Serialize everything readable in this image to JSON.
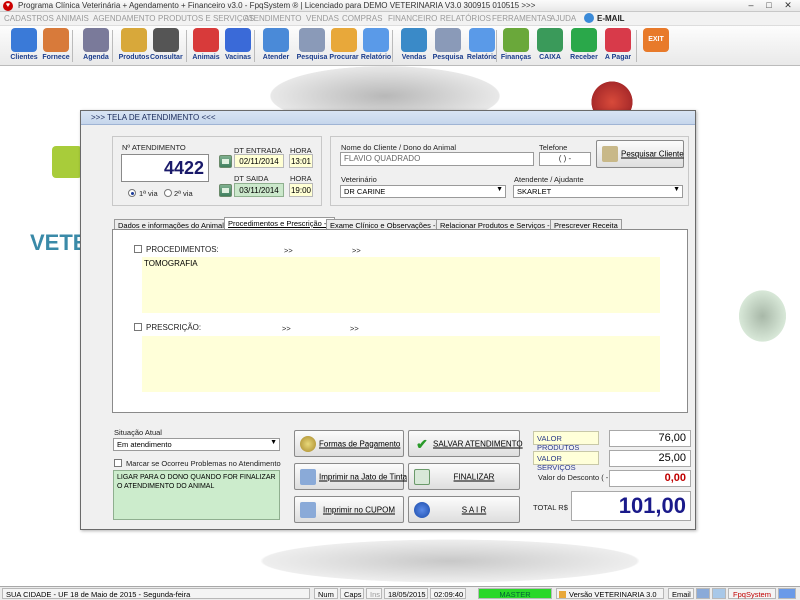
{
  "window": {
    "title": "Programa Clínica Veterinária + Agendamento + Financeiro v3.0 - FpqSystem ® | Licenciado para  DEMO VETERINARIA V3.0 300915 010515 >>>",
    "controls": {
      "minimize": "–",
      "maximize": "□",
      "close": "✕"
    }
  },
  "menu": [
    "CADASTROS",
    "ANIMAIS",
    "AGENDAMENTO",
    "PRODUTOS E SERVIÇOS",
    "ATENDIMENTO",
    "VENDAS",
    "COMPRAS",
    "FINANCEIRO",
    "RELATÓRIOS",
    "FERRAMENTAS",
    "AJUDA",
    "E-MAIL"
  ],
  "toolbar": [
    {
      "label": "Clientes",
      "icon": "people-icon",
      "color": "#3a7ad8"
    },
    {
      "label": "Fornece",
      "icon": "person-icon",
      "color": "#d87a3a"
    },
    {
      "label": "Agenda",
      "icon": "compass-icon",
      "color": "#7a7a9a"
    },
    {
      "label": "Produtos",
      "icon": "boxes-icon",
      "color": "#d8a83a"
    },
    {
      "label": "Consultar",
      "icon": "barcode-icon",
      "color": "#555555"
    },
    {
      "label": "Animais",
      "icon": "paw-icon",
      "color": "#d83a3a"
    },
    {
      "label": "Vacinas",
      "icon": "syringe-icon",
      "color": "#3a6ad8"
    },
    {
      "label": "Atender",
      "icon": "paw-plus-icon",
      "color": "#4a8ad8"
    },
    {
      "label": "Pesquisa",
      "icon": "search-doc-icon",
      "color": "#8a9ab8"
    },
    {
      "label": "Procurar",
      "icon": "folder-icon",
      "color": "#e8a83a"
    },
    {
      "label": "Relatório",
      "icon": "report-icon",
      "color": "#5a9ae8"
    },
    {
      "label": "Vendas",
      "icon": "monitor-icon",
      "color": "#3a8ac8"
    },
    {
      "label": "Pesquisa",
      "icon": "search-doc-icon",
      "color": "#8a9ab8"
    },
    {
      "label": "Relatório",
      "icon": "report-icon",
      "color": "#5a9ae8"
    },
    {
      "label": "Finanças",
      "icon": "chart-pie-icon",
      "color": "#6aa83a"
    },
    {
      "label": "CAIXA",
      "icon": "cash-register-icon",
      "color": "#3a9a5a"
    },
    {
      "label": "Receber",
      "icon": "dollar-green-icon",
      "color": "#2aa84a"
    },
    {
      "label": "A Pagar",
      "icon": "dollar-red-icon",
      "color": "#d83a4a"
    },
    {
      "label": "EXIT",
      "icon": "exit-icon",
      "color": "#e87a2a"
    }
  ],
  "background": {
    "logo_text": "VETE"
  },
  "dialog": {
    "title": ">>>   TELA DE ATENDIMENTO   <<<",
    "atendimento_label": "Nº ATENDIMENTO",
    "atendimento_number": "4422",
    "via1": "1ª via",
    "via2": "2ª via",
    "dt_entrada_label": "DT ENTRADA",
    "dt_entrada": "02/11/2014",
    "hora_label": "HORA",
    "hora_entrada": "13:01",
    "dt_saida_label": "DT SAIDA",
    "dt_saida": "03/11/2014",
    "hora_saida": "19:00",
    "cliente_label": "Nome do Cliente / Dono do Animal",
    "cliente": "FLAVIO QUADRADO",
    "telefone_label": "Telefone",
    "telefone": "(  )    -",
    "pesquisar_cliente": "Pesquisar Cliente",
    "veterinario_label": "Veterinário",
    "veterinario": "DR CARINE",
    "atendente_label": "Atendente / Ajudante",
    "atendente": "SKARLET",
    "tabs": [
      "Dados e informações do Animal ->",
      "Procedimentos e Prescrição ->",
      "Exame Clínico e Observações ->",
      "Relacionar Produtos e Serviços ->",
      "Prescrever Receita"
    ],
    "procedimentos_label": "PROCEDIMENTOS:",
    "procedimentos_arrows": [
      ">>",
      ">>"
    ],
    "procedimentos_text": "TOMOGRAFIA",
    "prescricao_label": "PRESCRIÇÃO:",
    "prescricao_arrows": [
      ">>",
      ">>"
    ],
    "prescricao_text": "",
    "situacao_label": "Situação Atual",
    "situacao": "Em atendimento",
    "problemas_label": "Marcar se Ocorreu Problemas no Atendimento",
    "observacao": "LIGAR PARA O DONO QUANDO FOR FINALIZAR O ATENDIMENTO DO ANIMAL",
    "btn_formas": "Formas de Pagamento",
    "btn_salvar": "SALVAR  ATENDIMENTO",
    "btn_jato": "Imprimir na Jato de Tinta",
    "btn_finalizar": "FINALIZAR",
    "btn_cupom": "Imprimir no CUPOM",
    "btn_sair": "S A I R",
    "valor_produtos_label": "VALOR PRODUTOS",
    "valor_produtos": "76,00",
    "valor_servicos_label": "VALOR SERVIÇOS",
    "valor_servicos": "25,00",
    "desconto_label": "Valor do Desconto ( - )",
    "desconto": "0,00",
    "total_label": "TOTAL R$",
    "total": "101,00"
  },
  "statusbar": {
    "cidade": "SUA CIDADE  -  UF 18 de Maio de 2015 - Segunda-feira",
    "num": "Num",
    "caps": "Caps",
    "ins": "Ins",
    "date": "18/05/2015",
    "time": "02:09:40",
    "user": "MASTER",
    "versao": "Versão VETERINARIA 3.0",
    "email": "Email",
    "brand": "FpqSystem"
  },
  "colors": {
    "accent_blue": "#1a1a8a",
    "desconto_red": "#c00000",
    "master_green": "#2ad82a"
  }
}
